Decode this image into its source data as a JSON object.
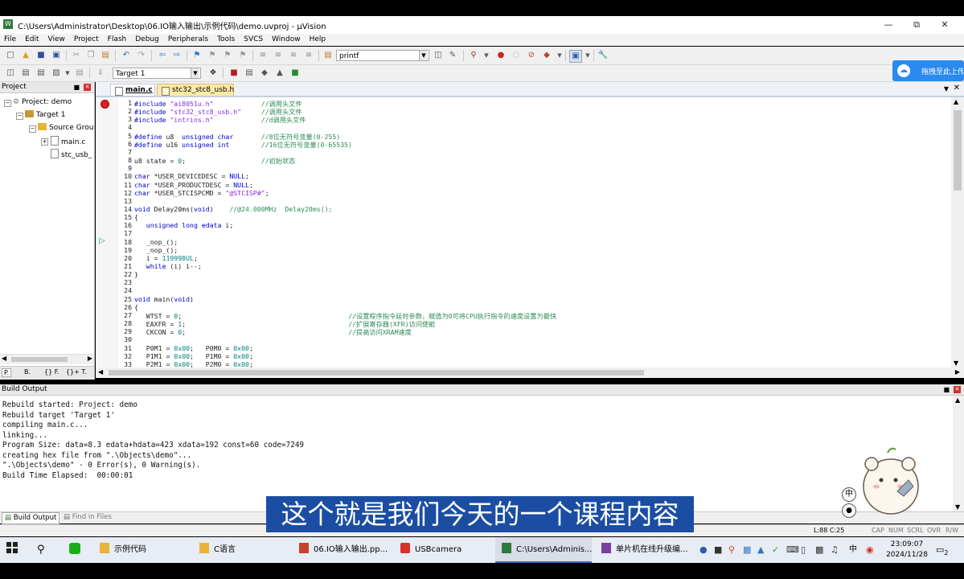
{
  "window": {
    "title": "C:\\Users\\Administrator\\Desktop\\06.IO输入输出\\示例代码\\demo.uvproj - µVision",
    "app_icon": "W"
  },
  "menu": [
    "File",
    "Edit",
    "View",
    "Project",
    "Flash",
    "Debug",
    "Peripherals",
    "Tools",
    "SVCS",
    "Window",
    "Help"
  ],
  "toolbar": {
    "find_value": "printf",
    "target_value": "Target 1"
  },
  "cloud_button": {
    "label": "拖拽至此上传"
  },
  "project_panel": {
    "title": "Project",
    "root": "Project: demo",
    "target": "Target 1",
    "group": "Source Grou",
    "files": [
      "main.c",
      "stc_usb_"
    ],
    "tabs": [
      "P.",
      "B.",
      "{} F.",
      "{}+ T."
    ]
  },
  "editor": {
    "tabs": [
      "main.c",
      "stc32_stc8_usb.h"
    ],
    "lines": [
      {
        "n": "1",
        "t": "#include \"ai8051u.h\"            //调用头文件"
      },
      {
        "n": "2",
        "t": "#include \"stc32_stc8_usb.h\"     //调用头文件"
      },
      {
        "n": "3",
        "t": "#include \"intrins.h\"            //d调用头文件"
      },
      {
        "n": "4",
        "t": ""
      },
      {
        "n": "5",
        "t": "#define u8  unsigned char       //8位无符号变量(0-255)"
      },
      {
        "n": "6",
        "t": "#define u16 unsigned int        //16位无符号变量(0-65535)"
      },
      {
        "n": "7",
        "t": ""
      },
      {
        "n": "8",
        "t": "u8 state = 0;                   //初始状态"
      },
      {
        "n": "9",
        "t": ""
      },
      {
        "n": "10",
        "t": "char *USER_DEVICEDESC = NULL;"
      },
      {
        "n": "11",
        "t": "char *USER_PRODUCTDESC = NULL;"
      },
      {
        "n": "12",
        "t": "char *USER_STCISPCMD = \"@STCISP#\";"
      },
      {
        "n": "13",
        "t": ""
      },
      {
        "n": "14",
        "t": "void Delay20ms(void)    //@24.000MHz  Delay20ms();"
      },
      {
        "n": "15",
        "t": "{"
      },
      {
        "n": "16",
        "t": "   unsigned long edata i;"
      },
      {
        "n": "17",
        "t": ""
      },
      {
        "n": "18",
        "t": "   _nop_();"
      },
      {
        "n": "19",
        "t": "   _nop_();"
      },
      {
        "n": "20",
        "t": "   i = 119998UL;"
      },
      {
        "n": "21",
        "t": "   while (i) i--;"
      },
      {
        "n": "22",
        "t": "}"
      },
      {
        "n": "23",
        "t": ""
      },
      {
        "n": "24",
        "t": ""
      },
      {
        "n": "25",
        "t": "void main(void)"
      },
      {
        "n": "26",
        "t": "{"
      },
      {
        "n": "27",
        "t": "   WTST = 0;                                          //设置程序指令延时参数，赋值为0可将CPU执行指令的速度设置为最快"
      },
      {
        "n": "28",
        "t": "   EAXFR = 1;                                         //扩展寄存器(XFR)访问使能"
      },
      {
        "n": "29",
        "t": "   CKCON = 0;                                         //提高访问XRAM速度"
      },
      {
        "n": "30",
        "t": ""
      },
      {
        "n": "31",
        "t": "   P0M1 = 0x00;   P0M0 = 0x00;"
      },
      {
        "n": "32",
        "t": "   P1M1 = 0x00;   P1M0 = 0x00;"
      },
      {
        "n": "33",
        "t": "   P2M1 = 0x00;   P2M0 = 0x00;"
      }
    ]
  },
  "build_output": {
    "title": "Build Output",
    "lines": [
      "Rebuild started: Project: demo",
      "Rebuild target 'Target 1'",
      "compiling main.c...",
      "linking...",
      "Program Size: data=8.3 edata+hdata=423 xdata=192 const=60 code=7249",
      "creating hex file from \".\\Objects\\demo\"...",
      "\".\\Objects\\demo\" - 0 Error(s), 0 Warning(s).",
      "Build Time Elapsed:  00:00:01"
    ],
    "tabs": [
      "Build Output",
      "Find in Files"
    ]
  },
  "status_bar": {
    "position": "L:88 C:25",
    "indicators": [
      "CAP",
      "NUM",
      "SCRL",
      "OVR",
      "R/W"
    ]
  },
  "subtitle": "这个就是我们今天的一个课程内容",
  "overlay_badge": "中",
  "taskbar": {
    "items": [
      {
        "label": "示例代码",
        "color": "#e8b339"
      },
      {
        "label": "C语言",
        "color": "#e8b339"
      },
      {
        "label": "06.IO输入输出.pp...",
        "color": "#c8402a"
      },
      {
        "label": "USBcamera",
        "color": "#d9302c"
      },
      {
        "label": "C:\\Users\\Adminis...",
        "color": "#2f7a3e"
      },
      {
        "label": "单片机在线升级编...",
        "color": "#7b3fa0"
      }
    ],
    "ime": "中",
    "time": "23:09:07",
    "date": "2024/11/28",
    "notifications": "2"
  }
}
